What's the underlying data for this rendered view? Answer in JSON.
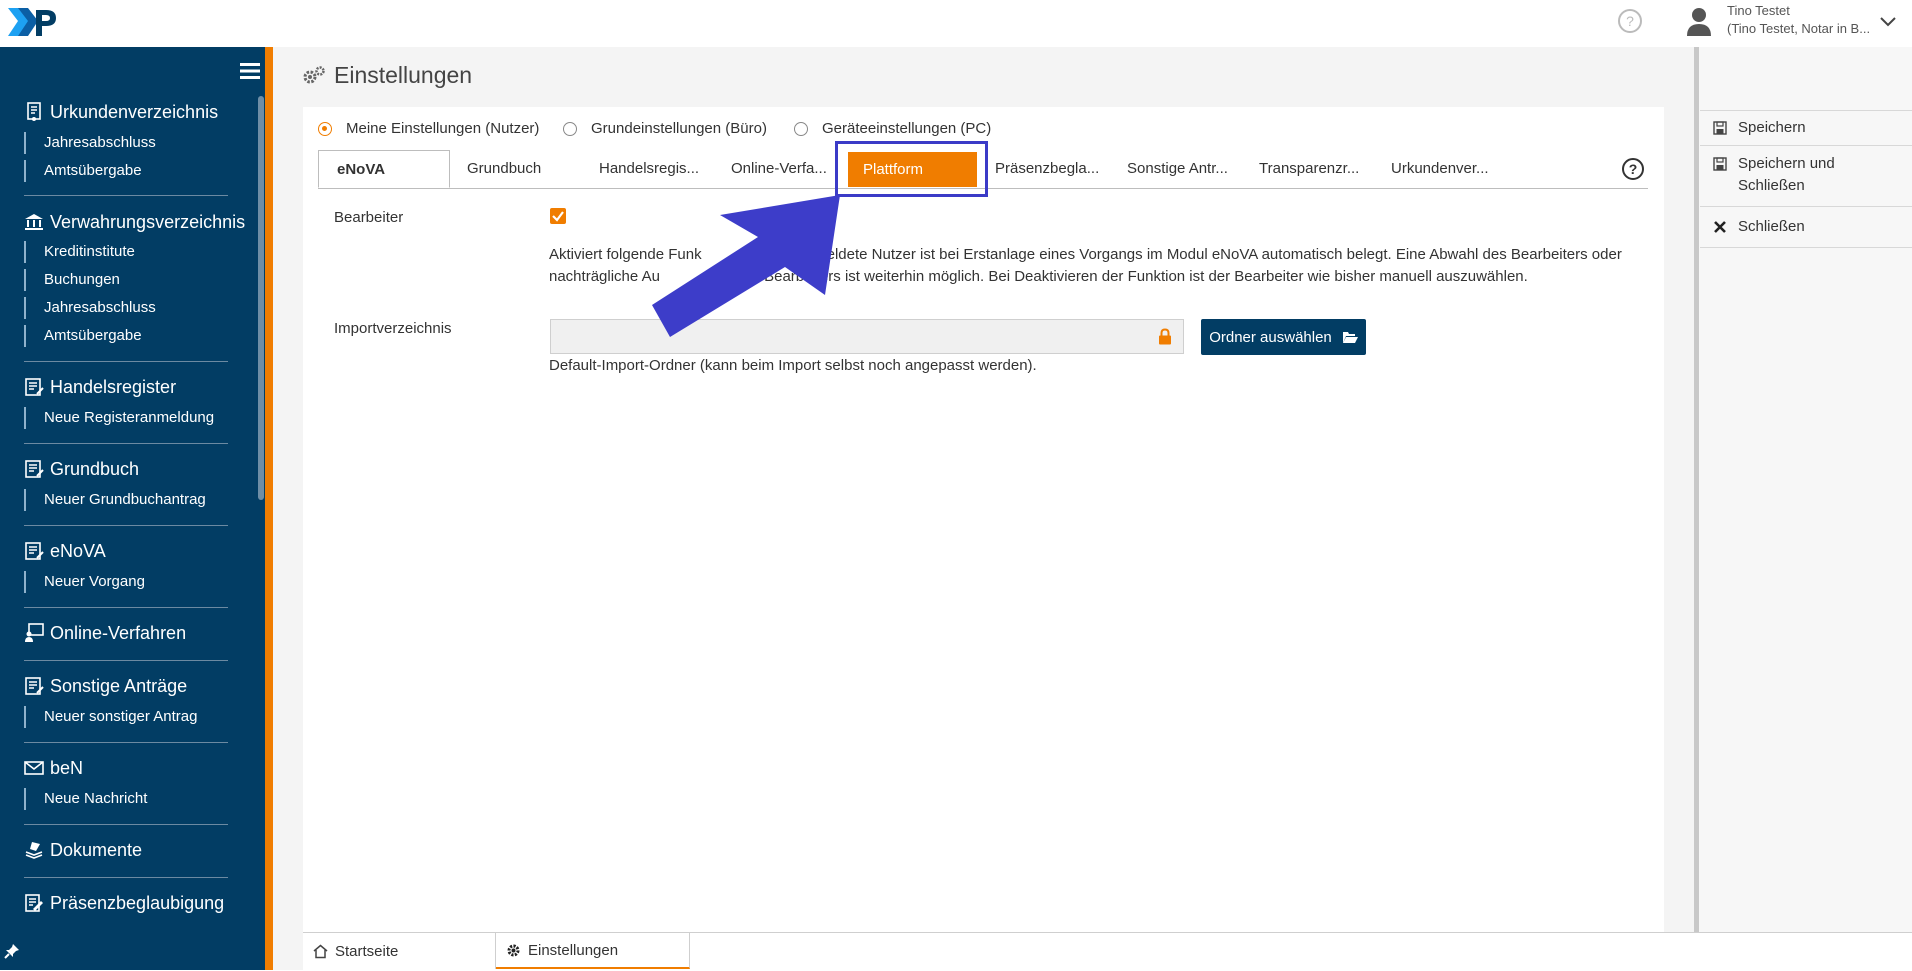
{
  "header": {
    "user_name": "Tino Testet",
    "user_detail": "(Tino Testet, Notar in B..."
  },
  "sidebar": {
    "sections": [
      {
        "title": "Urkundenverzeichnis",
        "icon": "document-icon",
        "items": [
          "Jahresabschluss",
          "Amtsübergabe"
        ]
      },
      {
        "title": "Verwahrungsverzeichnis",
        "icon": "bank-icon",
        "items": [
          "Kreditinstitute",
          "Buchungen",
          "Jahresabschluss",
          "Amtsübergabe"
        ]
      },
      {
        "title": "Handelsregister",
        "icon": "register-icon",
        "items": [
          "Neue Registeranmeldung"
        ]
      },
      {
        "title": "Grundbuch",
        "icon": "register-icon",
        "items": [
          "Neuer Grundbuchantrag"
        ]
      },
      {
        "title": "eNoVA",
        "icon": "register-icon",
        "items": [
          "Neuer Vorgang"
        ]
      },
      {
        "title": "Online-Verfahren",
        "icon": "presentation-icon",
        "items": []
      },
      {
        "title": "Sonstige Anträge",
        "icon": "register-icon",
        "items": [
          "Neuer sonstiger Antrag"
        ]
      },
      {
        "title": "beN",
        "icon": "mail-icon",
        "items": [
          "Neue Nachricht"
        ]
      },
      {
        "title": "Dokumente",
        "icon": "documents-stack-icon",
        "items": []
      },
      {
        "title": "Präsenzbeglaubigung",
        "icon": "edit-document-icon",
        "items": []
      }
    ]
  },
  "page": {
    "title": "Einstellungen",
    "radios": [
      {
        "label": "Meine Einstellungen (Nutzer)",
        "checked": true
      },
      {
        "label": "Grundeinstellungen (Büro)",
        "checked": false
      },
      {
        "label": "Geräteeinstellungen (PC)",
        "checked": false
      }
    ],
    "tabs": [
      "eNoVA",
      "Grundbuch",
      "Handelsregis...",
      "Online-Verfa...",
      "Plattform",
      "Präsenzbegla...",
      "Sonstige Antr...",
      "Transparenzr...",
      "Urkundenver..."
    ],
    "active_tab": "eNoVA",
    "highlighted_tab": "Plattform",
    "bearbeiter_label": "Bearbeiter",
    "bearbeiter_checked": true,
    "description_line1": "Aktiviert folgende Funk                   angemeldete Nutzer ist bei Erstanlage eines Vorgangs im Modul eNoVA automatisch belegt. Eine Abwahl des Bearbeiters oder",
    "description_line2": "nachträgliche Au                         Bearbeiters ist weiterhin möglich. Bei Deaktivieren der Funktion ist der Bearbeiter wie bisher manuell auszuwählen.",
    "import_label": "Importverzeichnis",
    "import_value": "",
    "folder_button": "Ordner auswählen",
    "import_hint": "Default-Import-Ordner (kann beim Import selbst noch angepasst werden)."
  },
  "bottom_tabs": [
    {
      "label": "Startseite",
      "icon": "home-icon"
    },
    {
      "label": "Einstellungen",
      "icon": "gear-icon",
      "active": true
    }
  ],
  "actions": [
    {
      "label": "Speichern",
      "icon": "save-icon"
    },
    {
      "label": "Speichern und",
      "label2": "Schließen",
      "icon": "save-icon"
    },
    {
      "label": "Schließen",
      "icon": "close-icon"
    }
  ],
  "colors": {
    "sidebar": "#023d64",
    "accent": "#f07d00",
    "highlight": "#3b3bc7"
  }
}
